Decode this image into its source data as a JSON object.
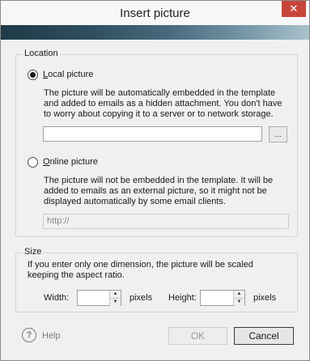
{
  "dialog": {
    "title": "Insert picture",
    "close_symbol": "✕",
    "close_icon": "close-icon"
  },
  "location": {
    "group_label": "Location",
    "local": {
      "label_first": "L",
      "label_rest": "ocal picture",
      "selected": true,
      "description": "The picture will be automatically embedded in the template and added to emails as a hidden attachment. You don't have to worry about copying it to a server or to network storage.",
      "path_value": "",
      "browse_label": "..."
    },
    "online": {
      "label_first": "O",
      "label_rest": "nline picture",
      "selected": false,
      "description": "The picture will not be embedded in the template. It will be added to emails as an external picture, so it might not be displayed automatically by some email clients.",
      "url_placeholder": "http://"
    }
  },
  "size": {
    "group_label": "Size",
    "description": "If you enter only one dimension, the picture will be scaled keeping the aspect ratio.",
    "width_label": "Width:",
    "width_value": "",
    "height_label": "Height:",
    "height_value": "",
    "unit": "pixels",
    "spin_up": "▲",
    "spin_down": "▼"
  },
  "footer": {
    "help_symbol": "?",
    "help_icon": "help-icon",
    "help_label": "Help",
    "ok_label": "OK",
    "ok_enabled": false,
    "cancel_label": "Cancel"
  }
}
